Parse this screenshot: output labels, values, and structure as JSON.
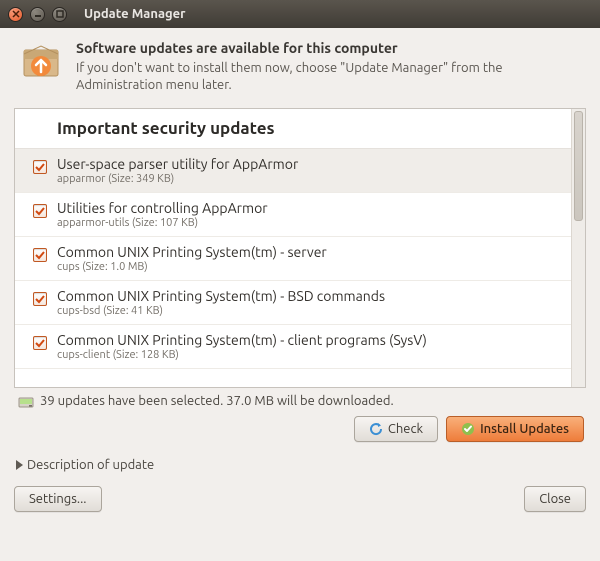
{
  "window": {
    "title": "Update Manager"
  },
  "header": {
    "title": "Software updates are available for this computer",
    "subtitle": "If you don't want to install them now, choose \"Update Manager\" from the Administration menu later."
  },
  "section_header": "Important security updates",
  "updates": [
    {
      "title": "User-space parser utility for AppArmor",
      "sub": "apparmor (Size: 349 KB)"
    },
    {
      "title": "Utilities for controlling AppArmor",
      "sub": "apparmor-utils (Size: 107 KB)"
    },
    {
      "title": "Common UNIX Printing System(tm) - server",
      "sub": "cups (Size: 1.0 MB)"
    },
    {
      "title": "Common UNIX Printing System(tm) - BSD commands",
      "sub": "cups-bsd (Size: 41 KB)"
    },
    {
      "title": "Common UNIX Printing System(tm) - client programs (SysV)",
      "sub": "cups-client (Size: 128 KB)"
    }
  ],
  "status": "39 updates have been selected. 37.0 MB will be downloaded.",
  "buttons": {
    "check": "Check",
    "install": "Install Updates",
    "settings": "Settings...",
    "close": "Close"
  },
  "desc_label": "Description of update"
}
